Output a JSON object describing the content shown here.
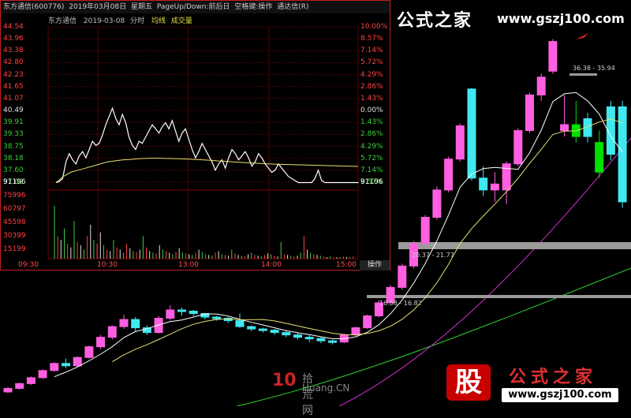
{
  "header": {
    "stock": "东方通信(600776)",
    "date": "2019年03月08日",
    "weekday": "星期五",
    "hint": "PageUp/Down:前后日",
    "space_hint": "空格键:操作",
    "source": "通达信(R)"
  },
  "subheader": {
    "name": "东方通信",
    "date": "2019-03-08",
    "mode": "分时",
    "ma_label": "均线",
    "vol_label": "成交量"
  },
  "price_axis_left": [
    "44.54",
    "43.96",
    "43.38",
    "42.80",
    "42.23",
    "41.65",
    "41.07",
    "40.49",
    "39.91",
    "39.33",
    "38.75",
    "38.18",
    "37.60",
    "37.02"
  ],
  "price_axis_right": [
    "10.00%",
    "8.57%",
    "7.14%",
    "5.72%",
    "4.29%",
    "2.86%",
    "1.43%",
    "0.00%",
    "1.43%",
    "2.86%",
    "4.29%",
    "5.72%",
    "7.14%",
    "8.57%"
  ],
  "volume_axis": [
    "91196",
    "75996",
    "60797",
    "45598",
    "30399",
    "15199"
  ],
  "volume_axis_right": [
    "91196"
  ],
  "time_axis": [
    "09:30",
    "10:30",
    "13:00",
    "14:00",
    "15:00"
  ],
  "operate_label": "操作",
  "watermark": {
    "top_brand": "公式之家",
    "top_url": "www.gszj100.com",
    "bottom_brand": "公式之家",
    "bottom_url": "www.gszj100.com",
    "badge": "股",
    "logo_num": "10",
    "logo_cn": "拾荒网",
    "logo_en": "Huang.CN"
  },
  "ma_bands": {
    "band1": "36.38 - 35.94",
    "band2": "20.37 - 21.77",
    "band3": "16.58 - 16.82"
  },
  "colors": {
    "up": "#ff5fe0",
    "down": "#40e8f0",
    "green": "#00e000",
    "ma5": "#ffffff",
    "ma10": "#e8e070",
    "ma20": "#d030d0",
    "ma60": "#30d030"
  },
  "chart_data": {
    "type": "candlestick",
    "title": "",
    "candles": [
      {
        "o": 9.0,
        "c": 9.3,
        "h": 9.4,
        "l": 8.9
      },
      {
        "o": 9.3,
        "c": 9.7,
        "h": 9.8,
        "l": 9.2
      },
      {
        "o": 9.7,
        "c": 10.2,
        "h": 10.3,
        "l": 9.6
      },
      {
        "o": 10.2,
        "c": 10.8,
        "h": 10.9,
        "l": 10.1
      },
      {
        "o": 10.8,
        "c": 11.4,
        "h": 11.5,
        "l": 10.7
      },
      {
        "o": 11.4,
        "c": 11.2,
        "h": 11.8,
        "l": 11.0
      },
      {
        "o": 11.2,
        "c": 11.9,
        "h": 12.0,
        "l": 11.1
      },
      {
        "o": 11.9,
        "c": 12.8,
        "h": 12.9,
        "l": 11.8
      },
      {
        "o": 12.8,
        "c": 13.6,
        "h": 13.8,
        "l": 12.6
      },
      {
        "o": 13.6,
        "c": 14.5,
        "h": 14.6,
        "l": 13.4
      },
      {
        "o": 14.5,
        "c": 15.1,
        "h": 15.5,
        "l": 14.3
      },
      {
        "o": 15.1,
        "c": 14.4,
        "h": 15.3,
        "l": 14.1
      },
      {
        "o": 14.4,
        "c": 14.0,
        "h": 14.6,
        "l": 13.8
      },
      {
        "o": 14.0,
        "c": 15.2,
        "h": 15.4,
        "l": 13.9
      },
      {
        "o": 15.2,
        "c": 15.9,
        "h": 16.3,
        "l": 15.0
      },
      {
        "o": 15.9,
        "c": 15.8,
        "h": 16.1,
        "l": 15.4
      },
      {
        "o": 15.8,
        "c": 15.6,
        "h": 15.9,
        "l": 15.4
      },
      {
        "o": 15.6,
        "c": 15.3,
        "h": 15.6,
        "l": 15.1
      },
      {
        "o": 15.3,
        "c": 15.2,
        "h": 15.4,
        "l": 15.0
      },
      {
        "o": 15.2,
        "c": 15.0,
        "h": 15.3,
        "l": 14.8
      },
      {
        "o": 15.0,
        "c": 14.5,
        "h": 15.6,
        "l": 14.4
      },
      {
        "o": 14.5,
        "c": 14.3,
        "h": 14.6,
        "l": 14.1
      },
      {
        "o": 14.3,
        "c": 14.2,
        "h": 14.4,
        "l": 14.0
      },
      {
        "o": 14.2,
        "c": 14.0,
        "h": 14.3,
        "l": 13.8
      },
      {
        "o": 14.0,
        "c": 13.8,
        "h": 14.2,
        "l": 13.6
      },
      {
        "o": 13.8,
        "c": 13.6,
        "h": 14.0,
        "l": 13.4
      },
      {
        "o": 13.6,
        "c": 13.5,
        "h": 13.8,
        "l": 13.2
      },
      {
        "o": 13.5,
        "c": 13.3,
        "h": 13.6,
        "l": 13.1
      },
      {
        "o": 13.3,
        "c": 13.2,
        "h": 13.4,
        "l": 13.0
      },
      {
        "o": 13.2,
        "c": 13.8,
        "h": 13.9,
        "l": 13.1
      },
      {
        "o": 13.8,
        "c": 14.4,
        "h": 14.5,
        "l": 13.7
      },
      {
        "o": 14.4,
        "c": 15.4,
        "h": 15.5,
        "l": 14.3
      },
      {
        "o": 15.4,
        "c": 16.5,
        "h": 16.7,
        "l": 15.3
      },
      {
        "o": 16.5,
        "c": 17.8,
        "h": 18.0,
        "l": 16.4
      },
      {
        "o": 17.8,
        "c": 19.6,
        "h": 19.8,
        "l": 17.6
      },
      {
        "o": 19.6,
        "c": 21.5,
        "h": 21.7,
        "l": 19.4
      },
      {
        "o": 21.5,
        "c": 23.7,
        "h": 23.9,
        "l": 21.3
      },
      {
        "o": 23.7,
        "c": 26.0,
        "h": 26.3,
        "l": 23.5
      },
      {
        "o": 26.0,
        "c": 28.6,
        "h": 28.8,
        "l": 25.8
      },
      {
        "o": 28.6,
        "c": 31.4,
        "h": 31.6,
        "l": 28.4
      },
      {
        "o": 34.5,
        "c": 27.0,
        "h": 34.6,
        "l": 26.8
      },
      {
        "o": 27.0,
        "c": 26.0,
        "h": 28.0,
        "l": 25.5
      },
      {
        "o": 26.0,
        "c": 26.5,
        "h": 27.5,
        "l": 25.0
      },
      {
        "o": 26.0,
        "c": 28.2,
        "h": 28.4,
        "l": 24.8
      },
      {
        "o": 28.2,
        "c": 31.0,
        "h": 31.2,
        "l": 28.0
      },
      {
        "o": 31.0,
        "c": 34.0,
        "h": 34.2,
        "l": 30.8
      },
      {
        "o": 34.0,
        "c": 35.5,
        "h": 35.8,
        "l": 33.5
      },
      {
        "o": 36.0,
        "c": 38.5,
        "h": 38.7,
        "l": 35.8
      },
      {
        "o": 31.0,
        "c": 31.5,
        "h": 34.0,
        "l": 30.5
      },
      {
        "o": 30.5,
        "c": 31.5,
        "h": 33.5,
        "l": 30.0
      },
      {
        "o": 32.0,
        "c": 30.5,
        "h": 32.5,
        "l": 30.0
      },
      {
        "o": 27.5,
        "c": 30.0,
        "h": 31.0,
        "l": 27.0
      },
      {
        "o": 33.0,
        "c": 29.0,
        "h": 33.5,
        "l": 28.5
      },
      {
        "o": 33.0,
        "c": 25.0,
        "h": 33.5,
        "l": 24.5
      }
    ],
    "intraday": {
      "prev_close": 40.49,
      "price": [
        37.0,
        37.05,
        37.2,
        38.0,
        38.4,
        38.1,
        37.9,
        38.3,
        38.5,
        38.2,
        38.6,
        39.0,
        38.8,
        38.9,
        39.3,
        39.8,
        40.2,
        40.6,
        40.1,
        39.8,
        40.3,
        39.9,
        39.2,
        38.8,
        38.6,
        39.0,
        38.9,
        39.2,
        39.5,
        39.8,
        39.6,
        39.4,
        39.7,
        39.9,
        39.6,
        40.0,
        39.5,
        39.0,
        39.4,
        39.6,
        39.1,
        38.6,
        38.2,
        38.5,
        38.9,
        38.6,
        38.3,
        38.0,
        37.6,
        37.9,
        38.1,
        37.7,
        38.2,
        38.6,
        38.4,
        38.1,
        38.3,
        38.5,
        38.2,
        37.8,
        38.0,
        38.4,
        38.2,
        37.9,
        37.7,
        37.5,
        37.6,
        37.9,
        37.7,
        37.5,
        37.3,
        37.2,
        37.1,
        37.0,
        37.0,
        37.0,
        37.0,
        37.0,
        37.2,
        37.6,
        37.1,
        37.0,
        37.0,
        37.0,
        37.0,
        37.0,
        37.0,
        37.0,
        37.0,
        37.0,
        37.0,
        37.0
      ],
      "avg": [
        37.0,
        37.3,
        37.5,
        37.6,
        37.7,
        37.8,
        37.9,
        38.0,
        38.05,
        38.1,
        38.12,
        38.15,
        38.17,
        38.18,
        38.18,
        38.17,
        38.16,
        38.15,
        38.14,
        38.12,
        38.1,
        38.08,
        38.05,
        38.03,
        38.0,
        37.98,
        37.96,
        37.94,
        37.92,
        37.9,
        37.89,
        37.88,
        37.87,
        37.86,
        37.85,
        37.84,
        37.83,
        37.82,
        37.81,
        37.8,
        37.79,
        37.78
      ],
      "volume": [
        70,
        30,
        25,
        40,
        20,
        15,
        50,
        22,
        18,
        12,
        30,
        45,
        25,
        20,
        35,
        18,
        12,
        10,
        25,
        15,
        12,
        8,
        20,
        14,
        10,
        9,
        12,
        30,
        15,
        10,
        8,
        7,
        18,
        12,
        10,
        8,
        6,
        9,
        14,
        8,
        7,
        6,
        5,
        8,
        12,
        9,
        6,
        5,
        4,
        8,
        10,
        6,
        5,
        4,
        12,
        7,
        5,
        4,
        3,
        6,
        8,
        5,
        4,
        3,
        5,
        7,
        6,
        4,
        3,
        22,
        6,
        5,
        4,
        3,
        4,
        8,
        30,
        12,
        8,
        6,
        5,
        4,
        3,
        2,
        3,
        2,
        2,
        2,
        3,
        2,
        2,
        3
      ]
    }
  }
}
